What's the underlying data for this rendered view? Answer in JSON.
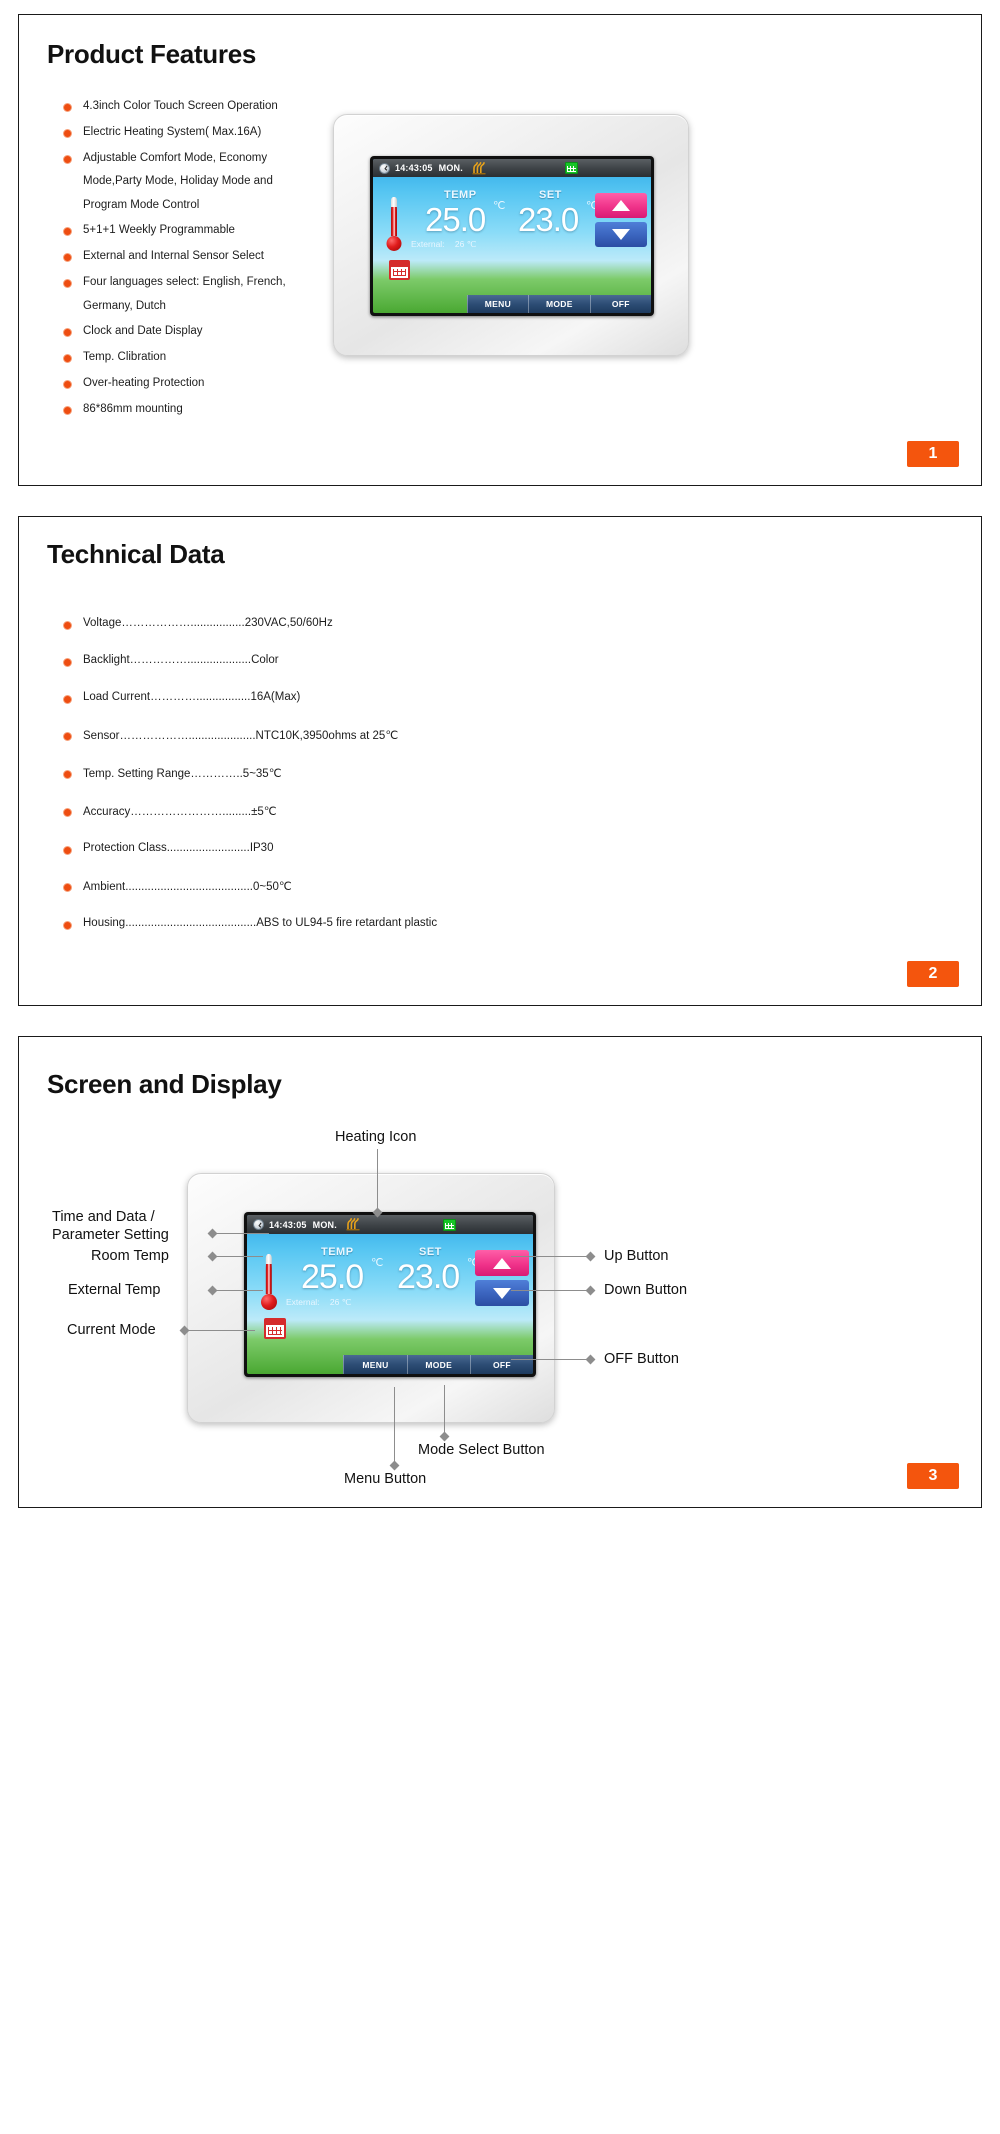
{
  "panels": {
    "features": {
      "title": "Product Features",
      "badge": "1",
      "items": [
        {
          "text": "4.3inch Color Touch Screen Operation",
          "continuation": []
        },
        {
          "text": "Electric Heating System( Max.16A)",
          "continuation": []
        },
        {
          "text": "Adjustable Comfort Mode, Economy",
          "continuation": [
            "Mode,Party Mode, Holiday Mode and",
            "Program Mode Control"
          ]
        },
        {
          "text": "5+1+1 Weekly Programmable",
          "continuation": []
        },
        {
          "text": "External and Internal Sensor Select",
          "continuation": []
        },
        {
          "text": "Four languages select: English, French,",
          "continuation": [
            "Germany, Dutch"
          ]
        },
        {
          "text": "Clock and Date Display",
          "continuation": []
        },
        {
          "text": "Temp. Clibration",
          "continuation": []
        },
        {
          "text": "Over-heating Protection",
          "continuation": []
        },
        {
          "text": "86*86mm mounting",
          "continuation": []
        }
      ]
    },
    "technical": {
      "title": "Technical Data",
      "badge": "2",
      "items": [
        {
          "label": "Voltage",
          "dots": "……………….................",
          "value": "230VAC,50/60Hz"
        },
        {
          "label": "Backlight",
          "dots": "……………....................",
          "value": "Color"
        },
        {
          "label": "Load Current",
          "dots": "………….................",
          "value": "16A(Max)"
        },
        {
          "label": "Sensor",
          "dots": "……………….....................",
          "value": "NTC10K,3950ohms at 25℃"
        },
        {
          "label": "Temp. Setting Range",
          "dots": "…………..",
          "value": "5~35℃"
        },
        {
          "label": "Accuracy",
          "dots": "…………………….........",
          "value": "±5℃"
        },
        {
          "label": "Protection Class",
          "dots": "..........................",
          "value": "IP30"
        },
        {
          "label": "Ambient",
          "dots": "........................................",
          "value": "0~50℃"
        },
        {
          "label": "Housing",
          "dots": ".........................................",
          "value": "ABS to UL94-5 fire retardant plastic"
        }
      ]
    },
    "screen": {
      "title": "Screen and Display",
      "badge": "3",
      "callouts": {
        "heating_icon": "Heating Icon",
        "time_and_data": "Time and Data /",
        "parameter_setting": "Parameter Setting",
        "room_temp": "Room Temp",
        "external_temp": "External Temp",
        "current_mode": "Current Mode",
        "up_button": "Up Button",
        "down_button": "Down Button",
        "off_button": "OFF Button",
        "mode_select_button": "Mode Select Button",
        "menu_button": "Menu Button"
      }
    }
  },
  "device_display": {
    "time": "14:43:05",
    "day": "MON.",
    "temp_label": "TEMP",
    "temp_value": "25.0",
    "temp_unit": "℃",
    "set_label": "SET",
    "set_value": "23.0",
    "set_unit": "℃",
    "external_label": "External:",
    "external_value": "26",
    "external_unit": "℃",
    "buttons": {
      "menu": "MENU",
      "mode": "MODE",
      "off": "OFF"
    }
  },
  "colors": {
    "accent": "#f4550d",
    "bullet": "#ee4d11",
    "bullet_ring": "#f6a07a",
    "up_button": "#f0338a",
    "down_button": "#3a63bd",
    "bottom_bar": "#2d4d75",
    "heat_icon": "#e8a21a",
    "calendar_green": "#17c427",
    "calendar_red": "#d52b2b"
  }
}
